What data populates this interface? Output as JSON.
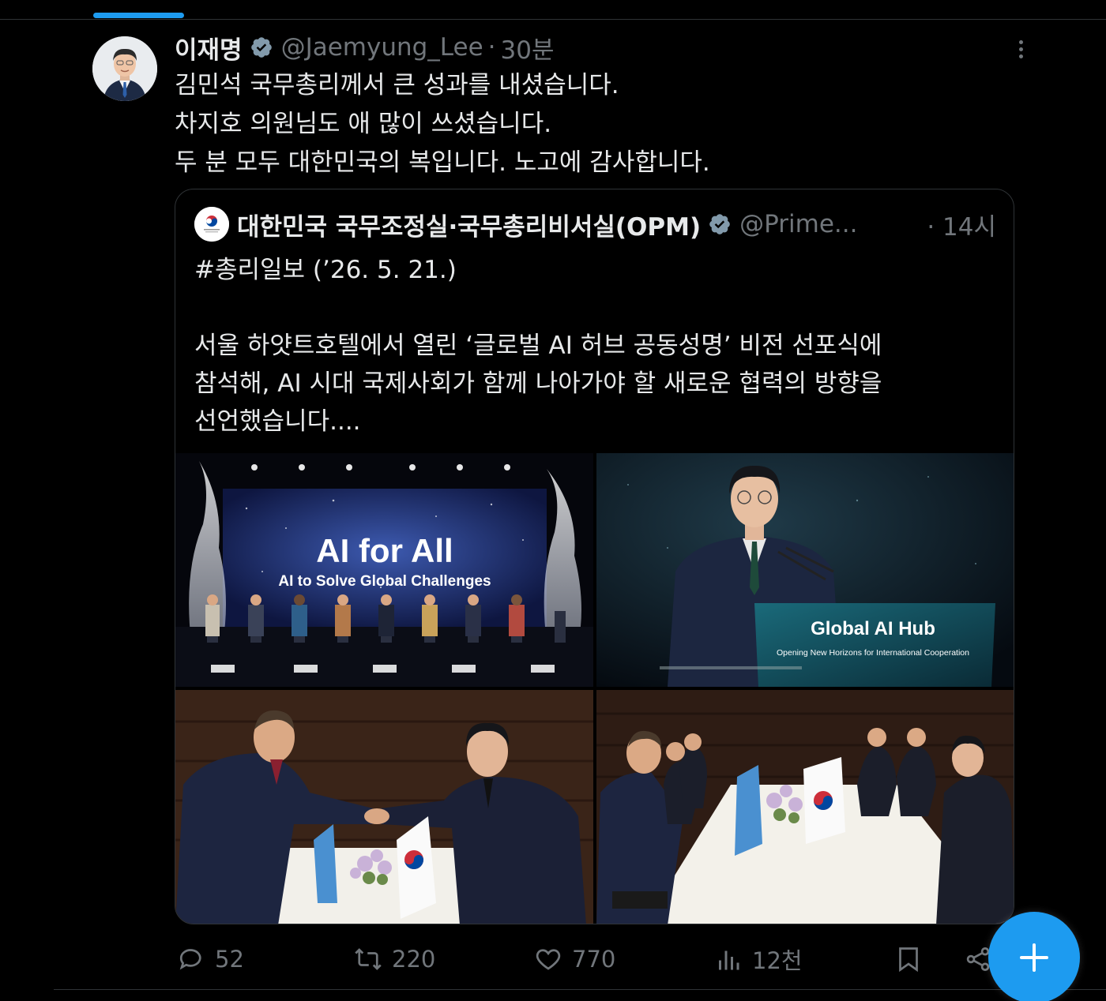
{
  "tweet": {
    "display_name": "이재명",
    "handle": "@Jaemyung_Lee",
    "separator": "·",
    "time": "30분",
    "lines": [
      "김민석 국무총리께서 큰 성과를 내셨습니다.",
      "차지호 의원님도 애 많이 쓰셨습니다.",
      "두 분 모두 대한민국의 복입니다. 노고에 감사합니다."
    ]
  },
  "quoted": {
    "display_name": "대한민국 국무조정실·국무총리비서실(OPM)",
    "handle": "@Prime...",
    "separator": "·",
    "time": "14시",
    "tag_line": "#총리일보 (’26. 5. 21.)",
    "body_lines": [
      "서울 하얏트호텔에서 열린 ‘글로벌 AI 허브 공동성명’ 비전 선포식에",
      "참석해, AI 시대 국제사회가 함께 나아가야 할 새로운 협력의 방향을",
      "선언했습니다...."
    ],
    "photos": {
      "stage_title": "AI for All",
      "stage_subtitle": "AI to Solve Global Challenges",
      "podium_title": "Global AI Hub",
      "podium_subtitle": "Opening New Horizons for International Cooperation"
    }
  },
  "actions": {
    "replies": "52",
    "reposts": "220",
    "likes": "770",
    "views": "12천"
  },
  "colors": {
    "accent": "#1d9bf0",
    "muted": "#71767b",
    "text": "#e7e9ea",
    "border": "#2f3336"
  }
}
